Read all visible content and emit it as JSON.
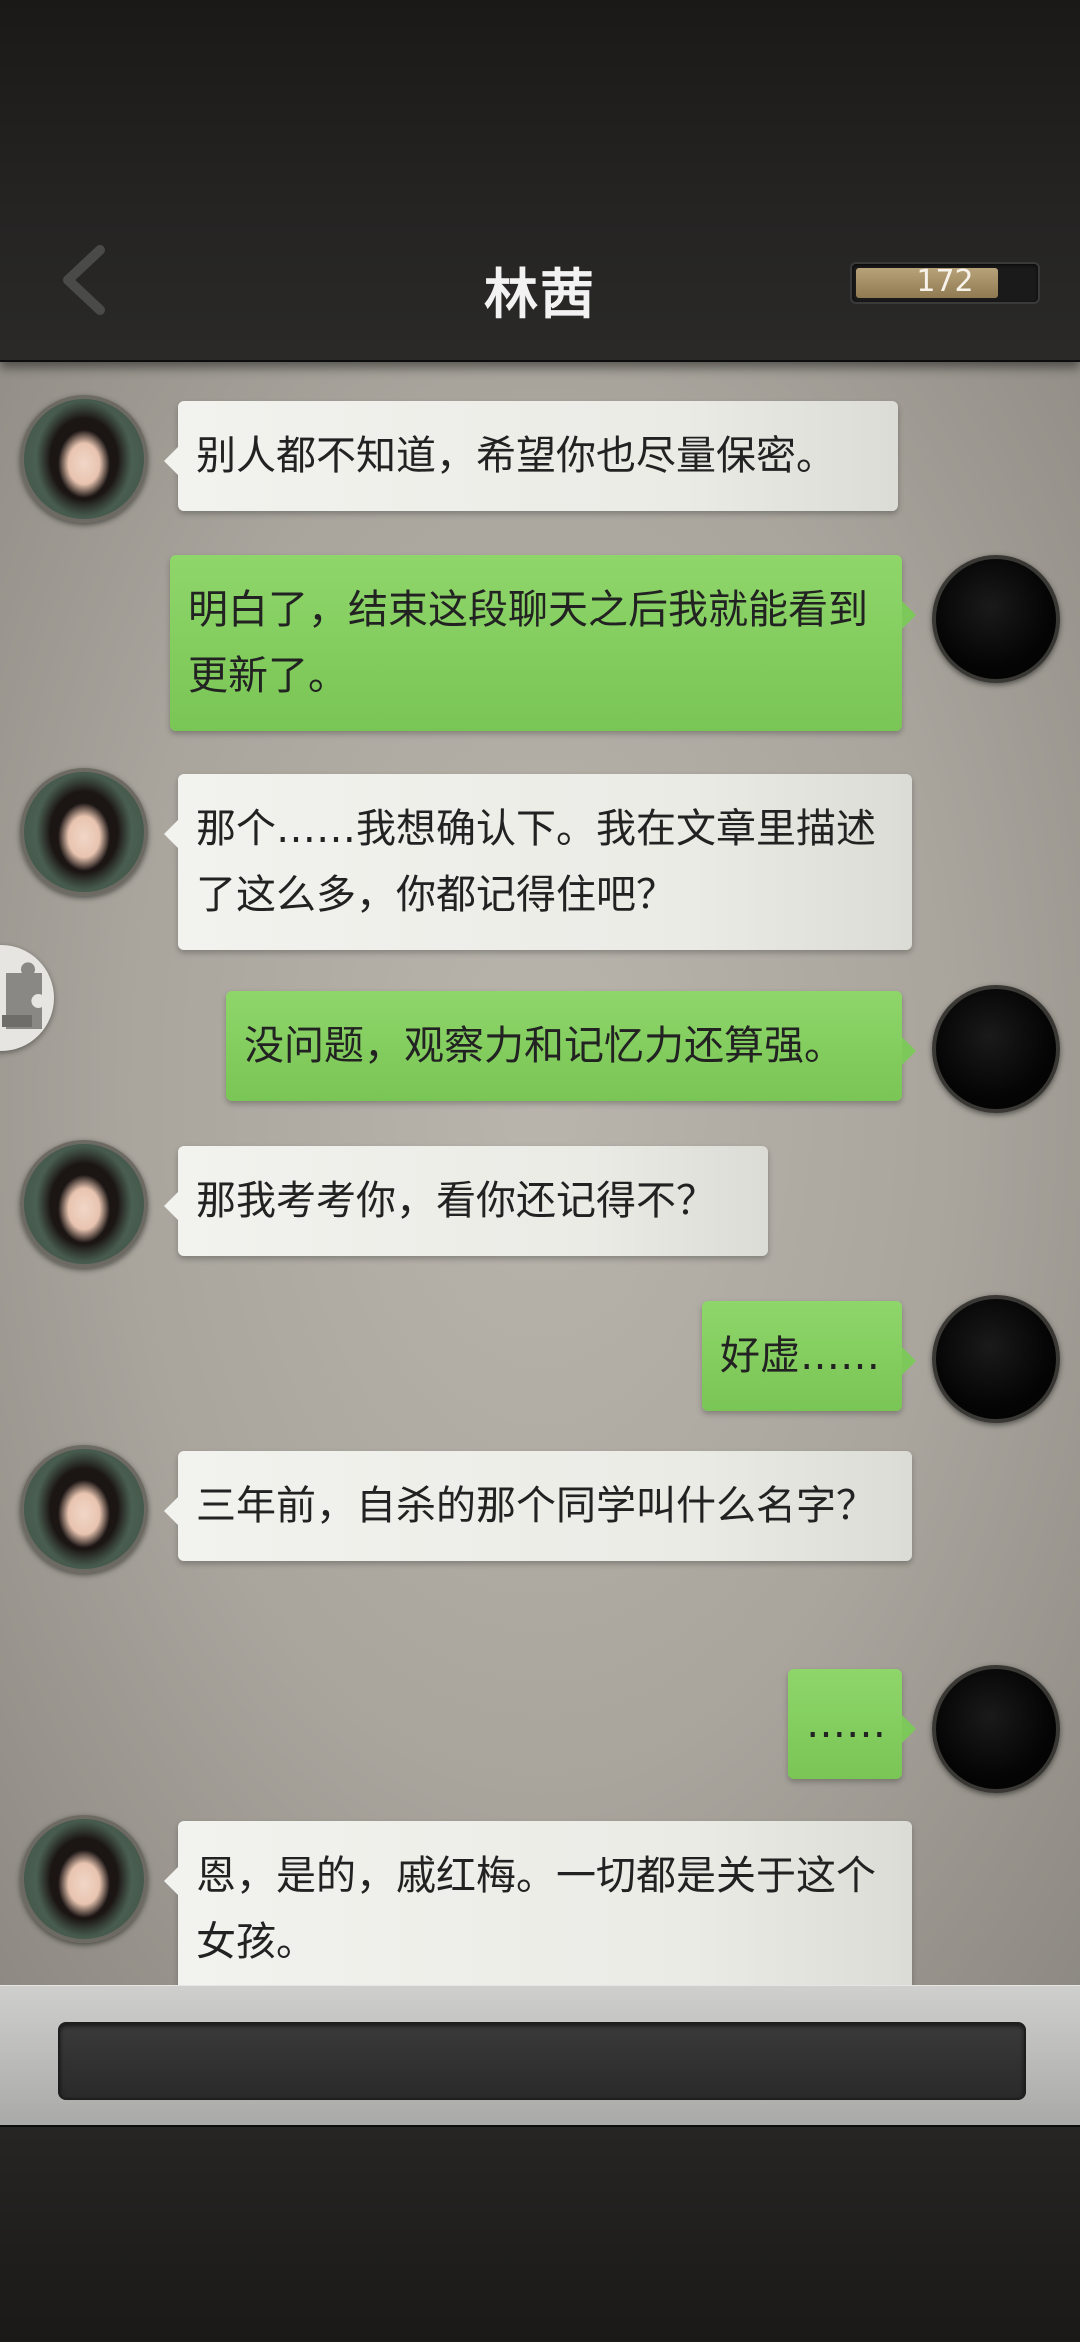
{
  "header": {
    "title": "林茜",
    "energy_value": "172",
    "energy_fraction": 0.8
  },
  "messages": [
    {
      "sender": "her",
      "text": "别人都不知道，希望你也尽量保密。"
    },
    {
      "sender": "me",
      "text": "明白了，结束这段聊天之后我就能看到更新了。"
    },
    {
      "sender": "her",
      "text": "那个……我想确认下。我在文章里描述了这么多，你都记得住吧？"
    },
    {
      "sender": "me",
      "text": "没问题，观察力和记忆力还算强。"
    },
    {
      "sender": "her",
      "text": "那我考考你，看你还记得不？"
    },
    {
      "sender": "me",
      "text": "好虚……"
    },
    {
      "sender": "her",
      "text": "三年前，自杀的那个同学叫什么名字？"
    },
    {
      "sender": "me",
      "text": "……"
    },
    {
      "sender": "her",
      "text": "恩，是的，戚红梅。一切都是关于这个女孩。"
    }
  ],
  "icons": {
    "back": "chevron-left-icon",
    "puzzle": "puzzle-icon"
  },
  "colors": {
    "her_bubble": "#f0f0ec",
    "my_bubble": "#84cf60",
    "energy_fill": "#a89068"
  }
}
